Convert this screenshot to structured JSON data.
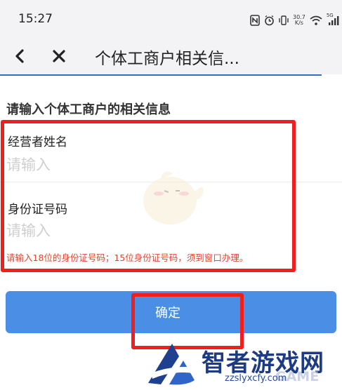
{
  "status_bar": {
    "time": "15:27",
    "network_speed_value": "30.7",
    "network_speed_unit": "K/s",
    "signal_label": "5G",
    "battery": "55"
  },
  "nav": {
    "title": "个体工商户相关信..."
  },
  "form": {
    "section_title": "请输入个体工商户的相关信息",
    "operator_name": {
      "label": "经营者姓名",
      "value": "",
      "placeholder": "请输入"
    },
    "id_number": {
      "label": "身份证号码",
      "value": "",
      "placeholder": "请输入"
    },
    "id_hint": "请输入18位的身份证号码；15位身份证号码，须到窗口办理。"
  },
  "actions": {
    "confirm_label": "确定"
  },
  "watermark": {
    "brand": "智者游戏网",
    "url": "zzslyxcfy.com",
    "overlay": "GAME"
  },
  "colors": {
    "accent": "#4a8fe5",
    "highlight": "#ef1f1f",
    "hint": "#e0452f",
    "nav_underline": "#2f6fbd"
  }
}
